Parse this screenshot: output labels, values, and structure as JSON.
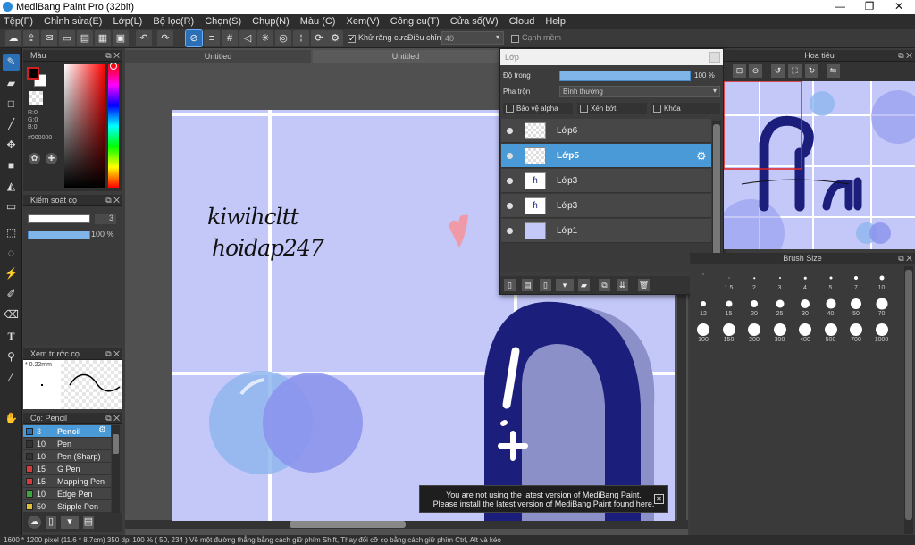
{
  "window": {
    "title": "MediBang Paint Pro (32bit)",
    "min": "—",
    "max": "❐",
    "close": "✕"
  },
  "menu": [
    "Tệp(F)",
    "Chỉnh sửa(E)",
    "Lớp(L)",
    "Bộ lọc(R)",
    "Chọn(S)",
    "Chụp(N)",
    "Màu (C)",
    "Xem(V)",
    "Công cụ(T)",
    "Cửa số(W)",
    "Cloud",
    "Help"
  ],
  "toolbar": {
    "antialias_label": "Khử răng cưa",
    "adjust_label": "Điều chỉnh",
    "adjust_value": "40",
    "edge_label": "Cạnh mềm"
  },
  "color_panel": {
    "title": "Màu",
    "r": "R:0",
    "g": "G:0",
    "b": "B:0",
    "hex": "#000000",
    "primary": "#000000",
    "secondary": "#ffffff"
  },
  "brush_control": {
    "title": "Kiểm soát cọ",
    "size": "3",
    "opacity": "100 %",
    "size_fill": 1.0,
    "opacity_fill": 1.0
  },
  "brush_preview": {
    "title": "Xem trước cọ",
    "size_text": "* 0.22mm"
  },
  "brush_list": {
    "title": "Cọ: Pencil",
    "items": [
      {
        "size": "3",
        "name": "Pencil",
        "color": "#2b6fb6",
        "selected": true
      },
      {
        "size": "10",
        "name": "Pen",
        "color": "#333333",
        "selected": false
      },
      {
        "size": "10",
        "name": "Pen (Sharp)",
        "color": "#333333",
        "selected": false
      },
      {
        "size": "15",
        "name": "G Pen",
        "color": "#d93a3a",
        "selected": false
      },
      {
        "size": "15",
        "name": "Mapping Pen",
        "color": "#d93a3a",
        "selected": false
      },
      {
        "size": "10",
        "name": "Edge Pen",
        "color": "#3aa83a",
        "selected": false
      },
      {
        "size": "50",
        "name": "Stipple Pen",
        "color": "#e0c030",
        "selected": false
      }
    ]
  },
  "doc_tabs": [
    "Untitled",
    "Untitled"
  ],
  "canvas_text": {
    "line1": "kiwihcltt",
    "line2": "hoidap247"
  },
  "layer_panel": {
    "title": "Lớp",
    "opacity_label": "Độ trong",
    "opacity_value": "100 %",
    "opacity_fill": 1.0,
    "blend_label": "Pha trộn",
    "blend_value": "Bình thường",
    "protect_alpha": "Bảo vệ alpha",
    "clip": "Xén bớt",
    "lock": "Khóa",
    "layers": [
      {
        "name": "Lớp6",
        "selected": false
      },
      {
        "name": "Lớp5",
        "selected": true
      },
      {
        "name": "Lớp3",
        "selected": false
      },
      {
        "name": "Lớp3",
        "selected": false
      },
      {
        "name": "Lớp1",
        "selected": false
      }
    ]
  },
  "navigator": {
    "title": "Hoa tiêu"
  },
  "brush_size": {
    "title": "Brush Size",
    "sizes": [
      "1.5",
      "2",
      "3",
      "4",
      "5",
      "7",
      "10",
      "12",
      "15",
      "20",
      "25",
      "30",
      "40",
      "50",
      "70",
      "100",
      "150",
      "200",
      "300",
      "400",
      "500",
      "700",
      "1000"
    ]
  },
  "notification": {
    "line1": "You are not using the latest version of MediBang Paint.",
    "line2": "Please install the latest version of MediBang Paint found here.",
    "close": "✕"
  },
  "status": {
    "text": "1600 * 1200 pixel   (11.6 * 8.7cm)   350 dpi   100 %   ( 50, 234 )   Vẽ một đường thẳng bằng cách giữ phím Shift, Thay đổi cỡ cọ bằng cách giữ phím Ctrl, Alt và kéo"
  }
}
